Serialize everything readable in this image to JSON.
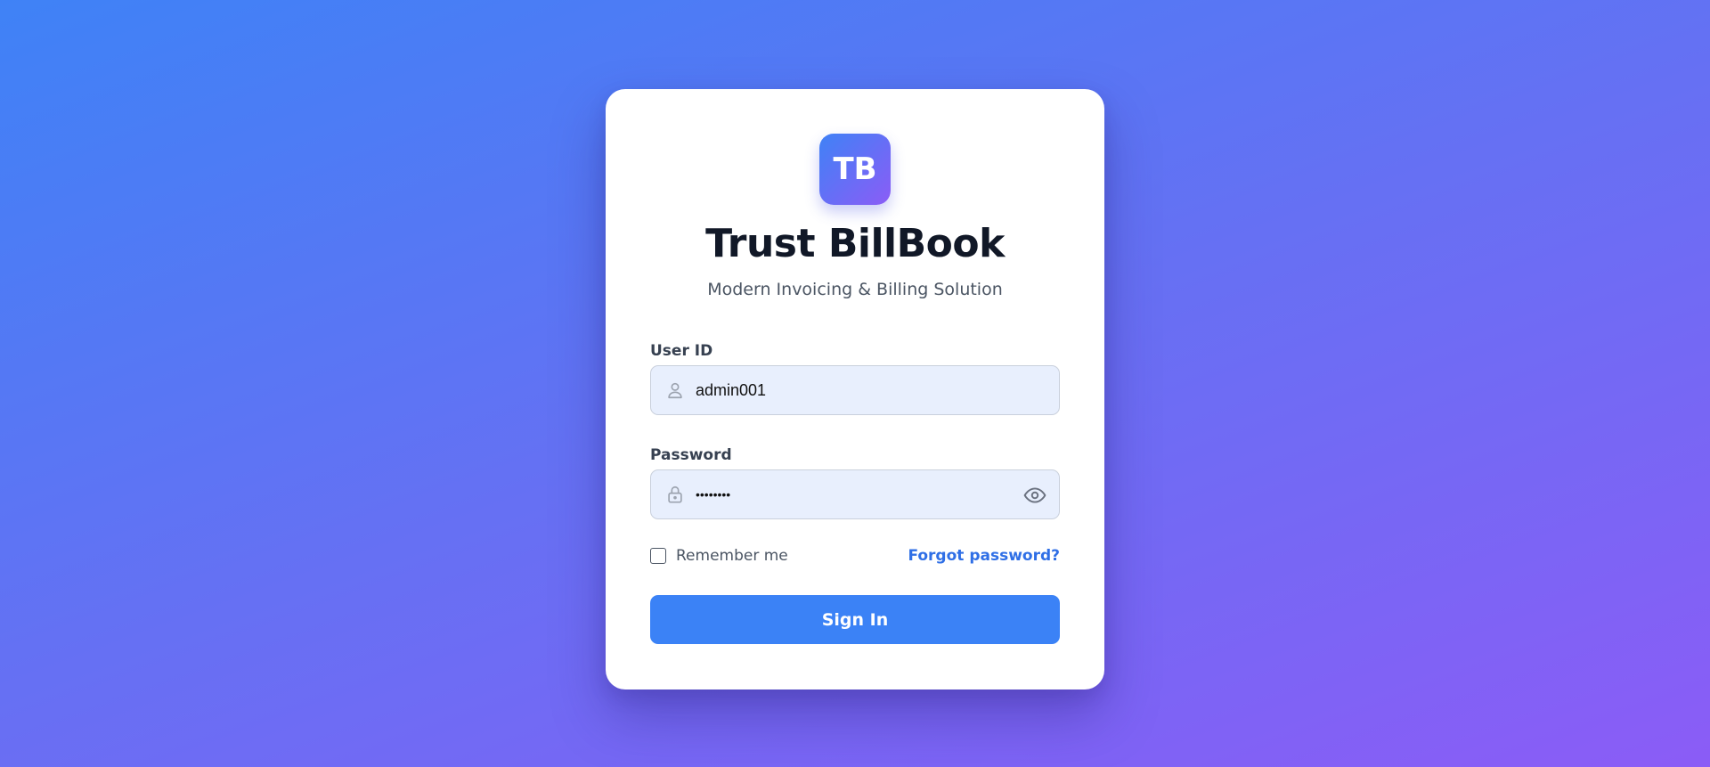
{
  "brand": {
    "logo_text": "TB",
    "title": "Trust BillBook",
    "subtitle": "Modern Invoicing & Billing Solution"
  },
  "form": {
    "user_id": {
      "label": "User ID",
      "value": "admin001",
      "icon": "user-icon"
    },
    "password": {
      "label": "Password",
      "value": "••••••••",
      "icon": "lock-icon",
      "toggle_icon": "eye-icon"
    },
    "remember_me": {
      "label": "Remember me",
      "checked": false
    },
    "forgot_password_label": "Forgot password?",
    "submit_label": "Sign In"
  },
  "colors": {
    "background_start": "#3f82f6",
    "background_end": "#8b5cf6",
    "primary_button": "#3b82f6",
    "link": "#2f6fe6",
    "title_text": "#111827",
    "input_background": "#e8effd"
  }
}
